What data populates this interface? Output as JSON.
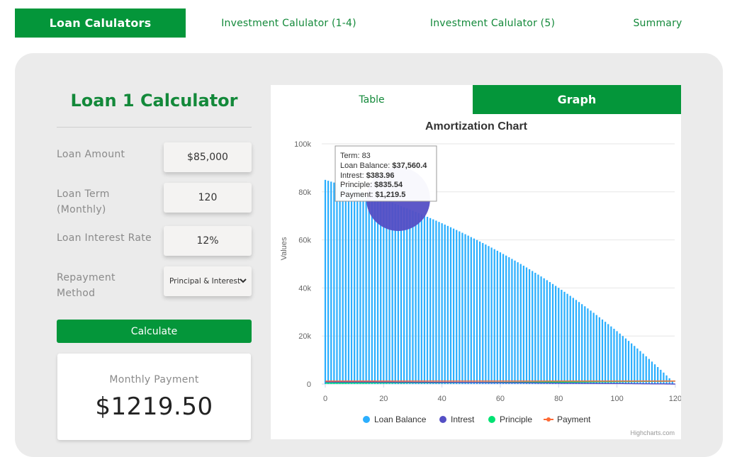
{
  "nav": {
    "tabs": [
      {
        "label": "Loan Calulators"
      },
      {
        "label": "Investment Calulator (1-4)"
      },
      {
        "label": "Investment Calulator (5)"
      },
      {
        "label": "Summary"
      }
    ]
  },
  "calculator": {
    "title": "Loan 1 Calculator",
    "fields": {
      "loan_amount": {
        "label": "Loan Amount",
        "value": "$85,000"
      },
      "loan_term": {
        "label_line1": "Loan Term",
        "label_line2": "(Monthly)",
        "value": "120"
      },
      "interest_rate": {
        "label": "Loan Interest Rate",
        "value": "12%"
      },
      "repayment": {
        "label_line1": "Repayment",
        "label_line2": "Method",
        "value": "Principal & Interest"
      }
    },
    "calculate_label": "Calculate",
    "result": {
      "label": "Monthly Payment",
      "value": "$1219.50"
    }
  },
  "chart_tabs": {
    "table": "Table",
    "graph": "Graph"
  },
  "colors": {
    "accent": "#04963a",
    "loan_balance": "#2caffe",
    "interest": "#544fc5",
    "principle": "#00e272",
    "payment": "#fe6a35"
  },
  "chart_data": {
    "type": "bar",
    "title": "Amortization Chart",
    "ylabel": "Values",
    "xlim": [
      0,
      121
    ],
    "ylim": [
      0,
      100000
    ],
    "x_ticks": [
      "0",
      "20",
      "40",
      "60",
      "80",
      "100",
      "120"
    ],
    "y_ticks": [
      "0",
      "20k",
      "40k",
      "60k",
      "80k",
      "100k"
    ],
    "loan_amount": 85000,
    "annual_rate": 0.12,
    "term_months": 120,
    "monthly_payment": 1219.5,
    "series": [
      {
        "name": "Loan Balance",
        "kind": "column"
      },
      {
        "name": "Intrest",
        "kind": "line"
      },
      {
        "name": "Principle",
        "kind": "line"
      },
      {
        "name": "Payment",
        "kind": "line"
      }
    ],
    "tooltip": {
      "term_label": "Term: ",
      "term": "83",
      "balance_label": "Loan Balance: ",
      "balance": "$37,560.4",
      "interest_label": "Intrest: ",
      "interest": "$383.96",
      "principle_label": "Principle: ",
      "principle": "$835.54",
      "payment_label": "Payment: ",
      "payment": "$1,219.5"
    },
    "credit": "Highcharts.com"
  }
}
